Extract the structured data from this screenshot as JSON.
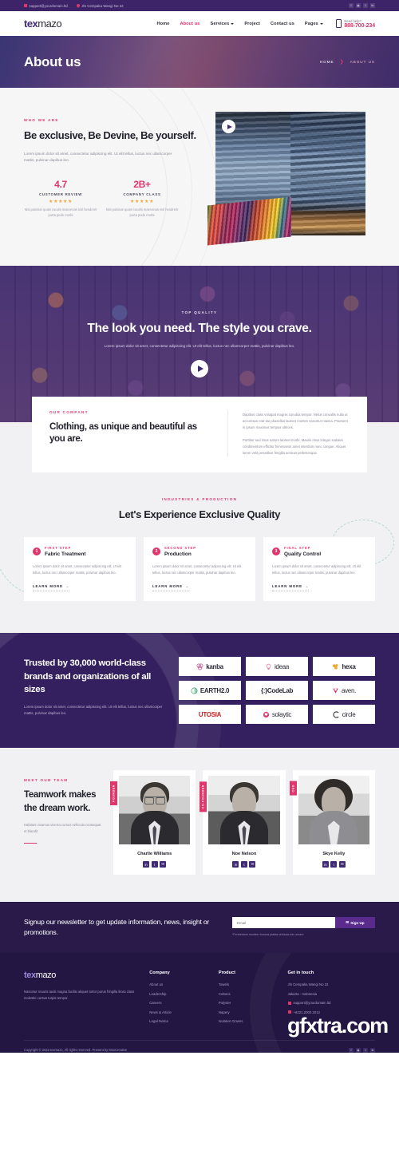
{
  "topbar": {
    "email": "support@yourdomain.ltd",
    "address": "Jln Cempaka Wangi No 22",
    "socials": [
      "f",
      "◉",
      "t",
      "in"
    ]
  },
  "nav": {
    "logo_a": "tex",
    "logo_b": "mazo",
    "items": [
      {
        "label": "Home",
        "active": false,
        "caret": false
      },
      {
        "label": "About us",
        "active": true,
        "caret": false
      },
      {
        "label": "Services",
        "active": false,
        "caret": true
      },
      {
        "label": "Project",
        "active": false,
        "caret": false
      },
      {
        "label": "Contact us",
        "active": false,
        "caret": false
      },
      {
        "label": "Pages",
        "active": false,
        "caret": true
      }
    ],
    "help_label": "Need help?",
    "phone": "888-700-234"
  },
  "hero": {
    "title": "About us",
    "crumb_home": "HOME",
    "crumb_sep": "❯",
    "crumb_current": "ABOUT US"
  },
  "who": {
    "eyebrow": "WHO WE ARE",
    "title": "Be exclusive, Be Devine, Be yourself.",
    "lead": "Lorem ipsum dolor sit amet, consectetur adipiscing elit. Ut elit tellus, luctus nec ullamcorper mattis, pulvinar dapibus leo.",
    "stats": [
      {
        "num": "4.7",
        "label": "CUSTOMER REVIEW",
        "stars": "★★★★★",
        "sub": "Nisi pulvinar quam iaculis maecenas nisl hendrerit porta pede morbi"
      },
      {
        "num": "2B+",
        "label": "COMPANY CLASS",
        "stars": "★★★★★",
        "sub": "Nisi pulvinar quam iaculis maecenas nisl hendrerit porta pede morbi"
      }
    ]
  },
  "quality": {
    "eyebrow": "TOP QUALITY",
    "title": "The look you need. The style you crave.",
    "text": "Lorem ipsum dolor sit amet, consectetur adipiscing elit. Ut elit tellus, luctus nec ullamcorper mattis, pulvinar dapibus leo."
  },
  "company": {
    "eyebrow": "OUR COMPANY",
    "title": "Clothing, as unique and beautiful as you are.",
    "para1": "Dapibus class volutpat magnis conubia tempor. Netus convallis nulla ut accumsan erat dui phasellus laoreet montes nascetur massa. Praesent in ipsum maximus tempus ultrices.",
    "para2": "Porttitor sed risus rutrum laoreet morbi. Mauris risus integer sodales condimentum efficitur himenaeos amet interdum nunc congue. Aliquet lorem velit penatibus fringilla aenean pellentesque."
  },
  "industries": {
    "eyebrow": "INDUSTRIES & PRODUCTION",
    "title": "Let's Experience Exclusive Quality",
    "cards": [
      {
        "num": "1",
        "step": "FIRST STEP",
        "title": "Fabric Treatment",
        "text": "Lorem ipsum dolor sit amet, consectetur adipiscing elit. Ut elit tellus, luctus nec ullamcorper mattis, pulvinar dapibus leo.",
        "cta": "LEARN MORE"
      },
      {
        "num": "2",
        "step": "SECOND STEP",
        "title": "Production",
        "text": "Lorem ipsum dolor sit amet, consectetur adipiscing elit. Ut elit tellus, luctus nec ullamcorper mattis, pulvinar dapibus leo.",
        "cta": "LEARN MORE"
      },
      {
        "num": "3",
        "step": "FINAL STEP",
        "title": "Quality Control",
        "text": "Lorem ipsum dolor sit amet, consectetur adipiscing elit. Ut elit tellus, luctus nec ullamcorper mattis, pulvinar dapibus leo.",
        "cta": "LEARN MORE"
      }
    ]
  },
  "trusted": {
    "title": "Trusted by 30,000 world-class brands and organizations of all sizes",
    "text": "Lorem ipsum dolor sit amet, consectetur adipiscing elit. Ut elit tellus, luctus nec ullamcorper mattis, pulvinar dapibus leo.",
    "logos": [
      {
        "name": "kanba",
        "style": "bold"
      },
      {
        "name": "ideaa",
        "style": "thin"
      },
      {
        "name": "hexa",
        "style": "bold"
      },
      {
        "name": "EARTH2.0",
        "style": "bold"
      },
      {
        "name": "{:}CodeLab",
        "style": "bold"
      },
      {
        "name": "aven.",
        "style": "thin"
      },
      {
        "name": "UTOSIA",
        "style": "bold"
      },
      {
        "name": "solaytic",
        "style": "thin"
      },
      {
        "name": "circle",
        "style": "thin"
      }
    ]
  },
  "team": {
    "eyebrow": "MEET OUR TEAM",
    "title": "Teamwork makes the dream work.",
    "text": "Habitant vivamus viverra cursus vehicula consequat et blandit",
    "members": [
      {
        "name": "Charlie Williams",
        "tag": "FOUNDER",
        "socials": [
          "in",
          "t",
          "✉"
        ]
      },
      {
        "name": "Noe Nelson",
        "tag": "CO-FOUNDER",
        "socials": [
          "in",
          "t",
          "✉"
        ]
      },
      {
        "name": "Skye Kelly",
        "tag": "CEO",
        "socials": [
          "in",
          "t",
          "✉"
        ]
      }
    ]
  },
  "newsletter": {
    "title": "Signup our newsletter to get update information, news, insight or promotions.",
    "placeholder": "Email",
    "button": "Sign Up",
    "note": "*Fermentum montes rhoncus platea vehicula nec ornare"
  },
  "footer": {
    "logo_a": "tex",
    "logo_b": "mazo",
    "about": "Nascetur mauris taciti magna facilisi aliquet tortor purus fringilla litora class molestie cursus turpis tempor.",
    "columns": [
      {
        "title": "Company",
        "items": [
          "About us",
          "Leadership",
          "Careers",
          "News & Article",
          "Legal Notice"
        ]
      },
      {
        "title": "Product",
        "items": [
          "Towels",
          "Cottons",
          "Polyster",
          "Napery",
          "Isolation Gowns"
        ]
      }
    ],
    "contact_title": "Get in touch",
    "contact": [
      {
        "text": "Jln Cempaka Wangi No 22",
        "icon": false
      },
      {
        "text": "Jakarta - Indonesia",
        "icon": false
      },
      {
        "text": "support@yourdomain.ltd",
        "icon": true
      },
      {
        "text": "+6221.2002.2012",
        "icon": true
      }
    ],
    "copyright": "Copyright © 2022 texmazo, All rights reserved. Present by MoxCreative",
    "socials": [
      "f",
      "◉",
      "t",
      "in"
    ],
    "watermark": "gfxtra.com"
  }
}
